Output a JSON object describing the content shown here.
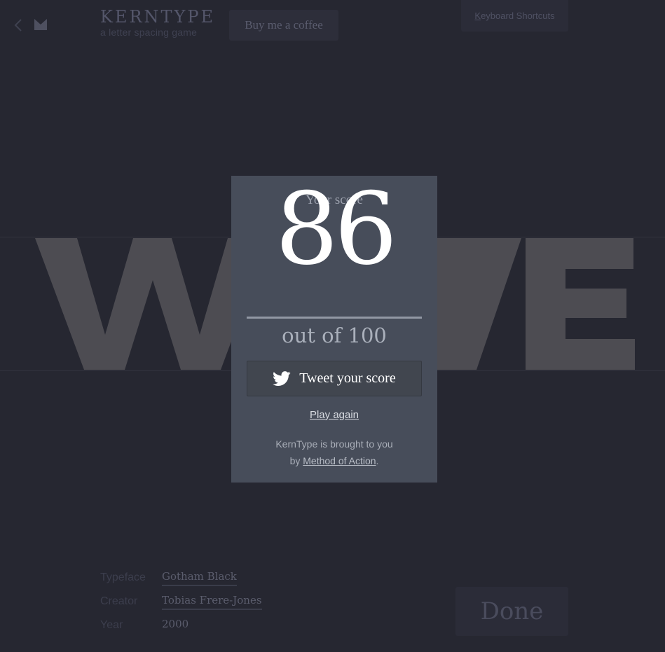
{
  "header": {
    "brand_title": "KERNTYPE",
    "brand_subtitle": "a letter spacing game",
    "coffee_label": "Buy me a coffee",
    "shortcuts_first_letter": "K",
    "shortcuts_rest": "eyboard Shortcuts"
  },
  "game": {
    "word": "WAVE",
    "letter_color": "#4d4c52"
  },
  "result": {
    "score_label": "Your score",
    "score": "86",
    "out_of": "out of 100",
    "tweet_label": "Tweet your score",
    "play_again": "Play again",
    "credit_line1": "KernType is brought to you",
    "credit_by": "by ",
    "credit_link": "Method of Action",
    "credit_end": "."
  },
  "info": {
    "typeface_label": "Typeface",
    "typeface_value": "Gotham Black",
    "creator_label": "Creator",
    "creator_value": "Tobias Frere-Jones",
    "year_label": "Year",
    "year_value": "2000"
  },
  "done_label": "Done",
  "icons": {
    "back": "chevron-left-icon",
    "logo": "moa-logo-icon",
    "twitter": "twitter-bird-icon"
  },
  "colors": {
    "background": "#262731",
    "modal": "#474d5a",
    "score_text": "#ffffff"
  }
}
